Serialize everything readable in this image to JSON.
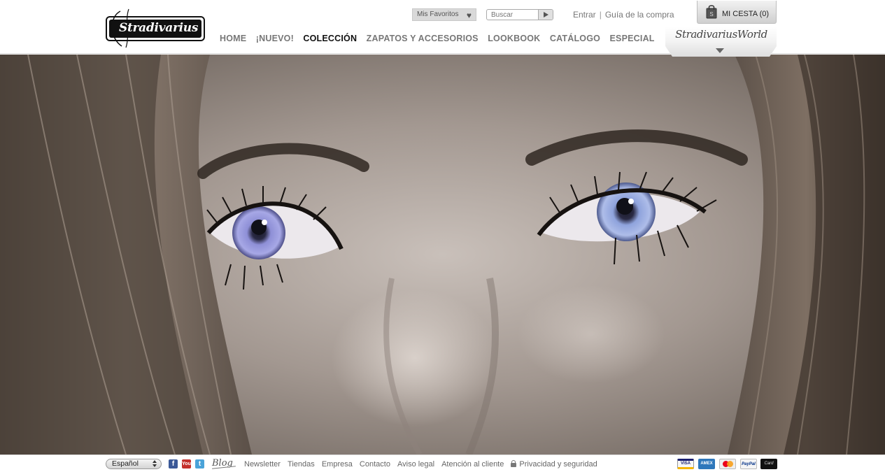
{
  "brand": {
    "logo_text": "Stradivarius",
    "world_label": "StradivariusWorld"
  },
  "header": {
    "favorites_label": "Mis Favoritos",
    "search_placeholder": "Buscar",
    "login_label": "Entrar",
    "separator": "|",
    "guide_label": "Guía de la compra",
    "cart_label": "MI CESTA (0)"
  },
  "nav": {
    "items": [
      {
        "label": "HOME",
        "active": false
      },
      {
        "label": "¡NUEVO!",
        "active": false
      },
      {
        "label": "COLECCIÓN",
        "active": true
      },
      {
        "label": "ZAPATOS Y ACCESORIOS",
        "active": false
      },
      {
        "label": "LOOKBOOK",
        "active": false
      },
      {
        "label": "CATÁLOGO",
        "active": false
      },
      {
        "label": "ESPECIAL",
        "active": false
      }
    ]
  },
  "footer": {
    "language": "Español",
    "blog_label": "Blog",
    "social": {
      "facebook": "f",
      "youtube": "You",
      "twitter": "t"
    },
    "links": {
      "newsletter": "Newsletter",
      "stores": "Tiendas",
      "company": "Empresa",
      "contact": "Contacto",
      "legal": "Aviso legal",
      "customer_service": "Atención al cliente",
      "privacy": "Privacidad y seguridad"
    },
    "payment": {
      "visa": "VISA",
      "amex": "AMEX",
      "paypal": "PayPal",
      "other": "Card"
    }
  },
  "colors": {
    "nav_inactive": "#777777",
    "nav_active": "#111111",
    "eye_iris": "#8e8fd6",
    "skin": "#9b8f88",
    "hair": "#5a4f47"
  },
  "icons": {
    "favorites": "heart-icon",
    "search": "play-arrow-icon",
    "cart": "shopping-bag-icon",
    "world_toggle": "chevron-down-icon",
    "privacy": "lock-icon"
  }
}
